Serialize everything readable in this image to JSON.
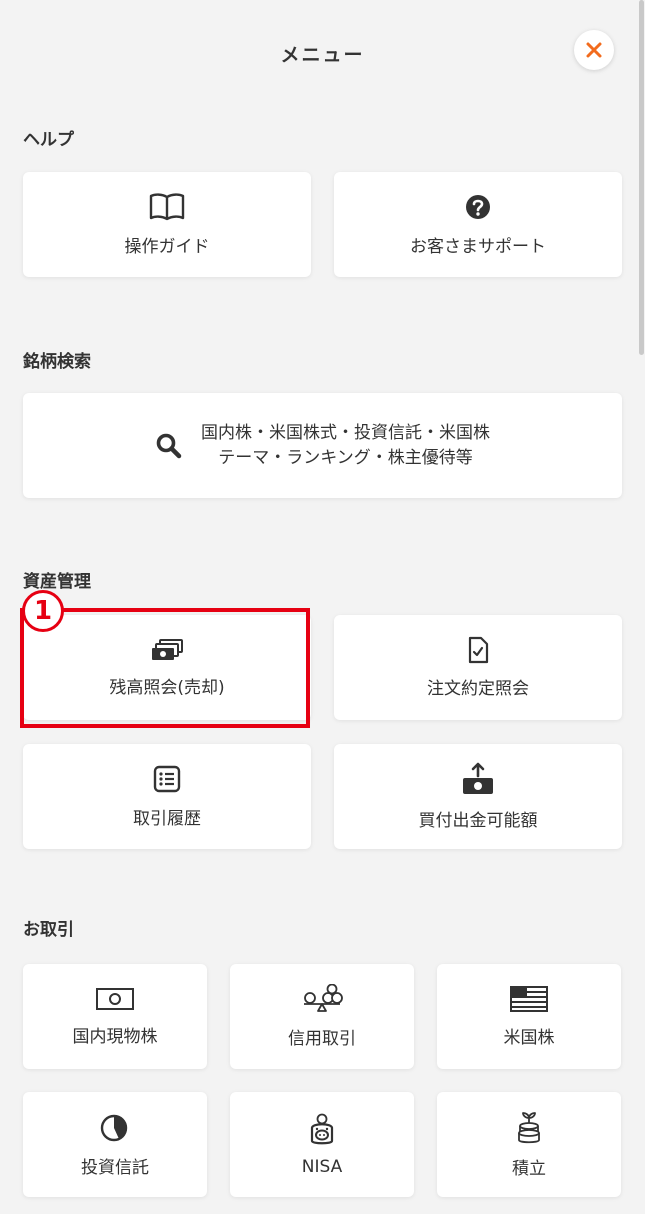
{
  "header": {
    "title": "メニュー",
    "close_color": "#f26b1d"
  },
  "help": {
    "title": "ヘルプ",
    "guide_label": "操作ガイド",
    "support_label": "お客さまサポート"
  },
  "search": {
    "title": "銘柄検索",
    "line1": "国内株・米国株式・投資信託・米国株",
    "line2": "テーマ・ランキング・株主優待等"
  },
  "assets": {
    "title": "資産管理",
    "holdings_label": "残高照会(売却)",
    "orders_label": "注文約定照会",
    "history_label": "取引履歴",
    "buying_power_label": "買付出金可能額"
  },
  "trading": {
    "title": "お取引",
    "domestic_label": "国内現物株",
    "margin_label": "信用取引",
    "us_label": "米国株",
    "fund_label": "投資信託",
    "nisa_label": "NISA",
    "tsumitate_label": "積立"
  },
  "annotation": {
    "marker": "1",
    "color": "#e60012"
  }
}
